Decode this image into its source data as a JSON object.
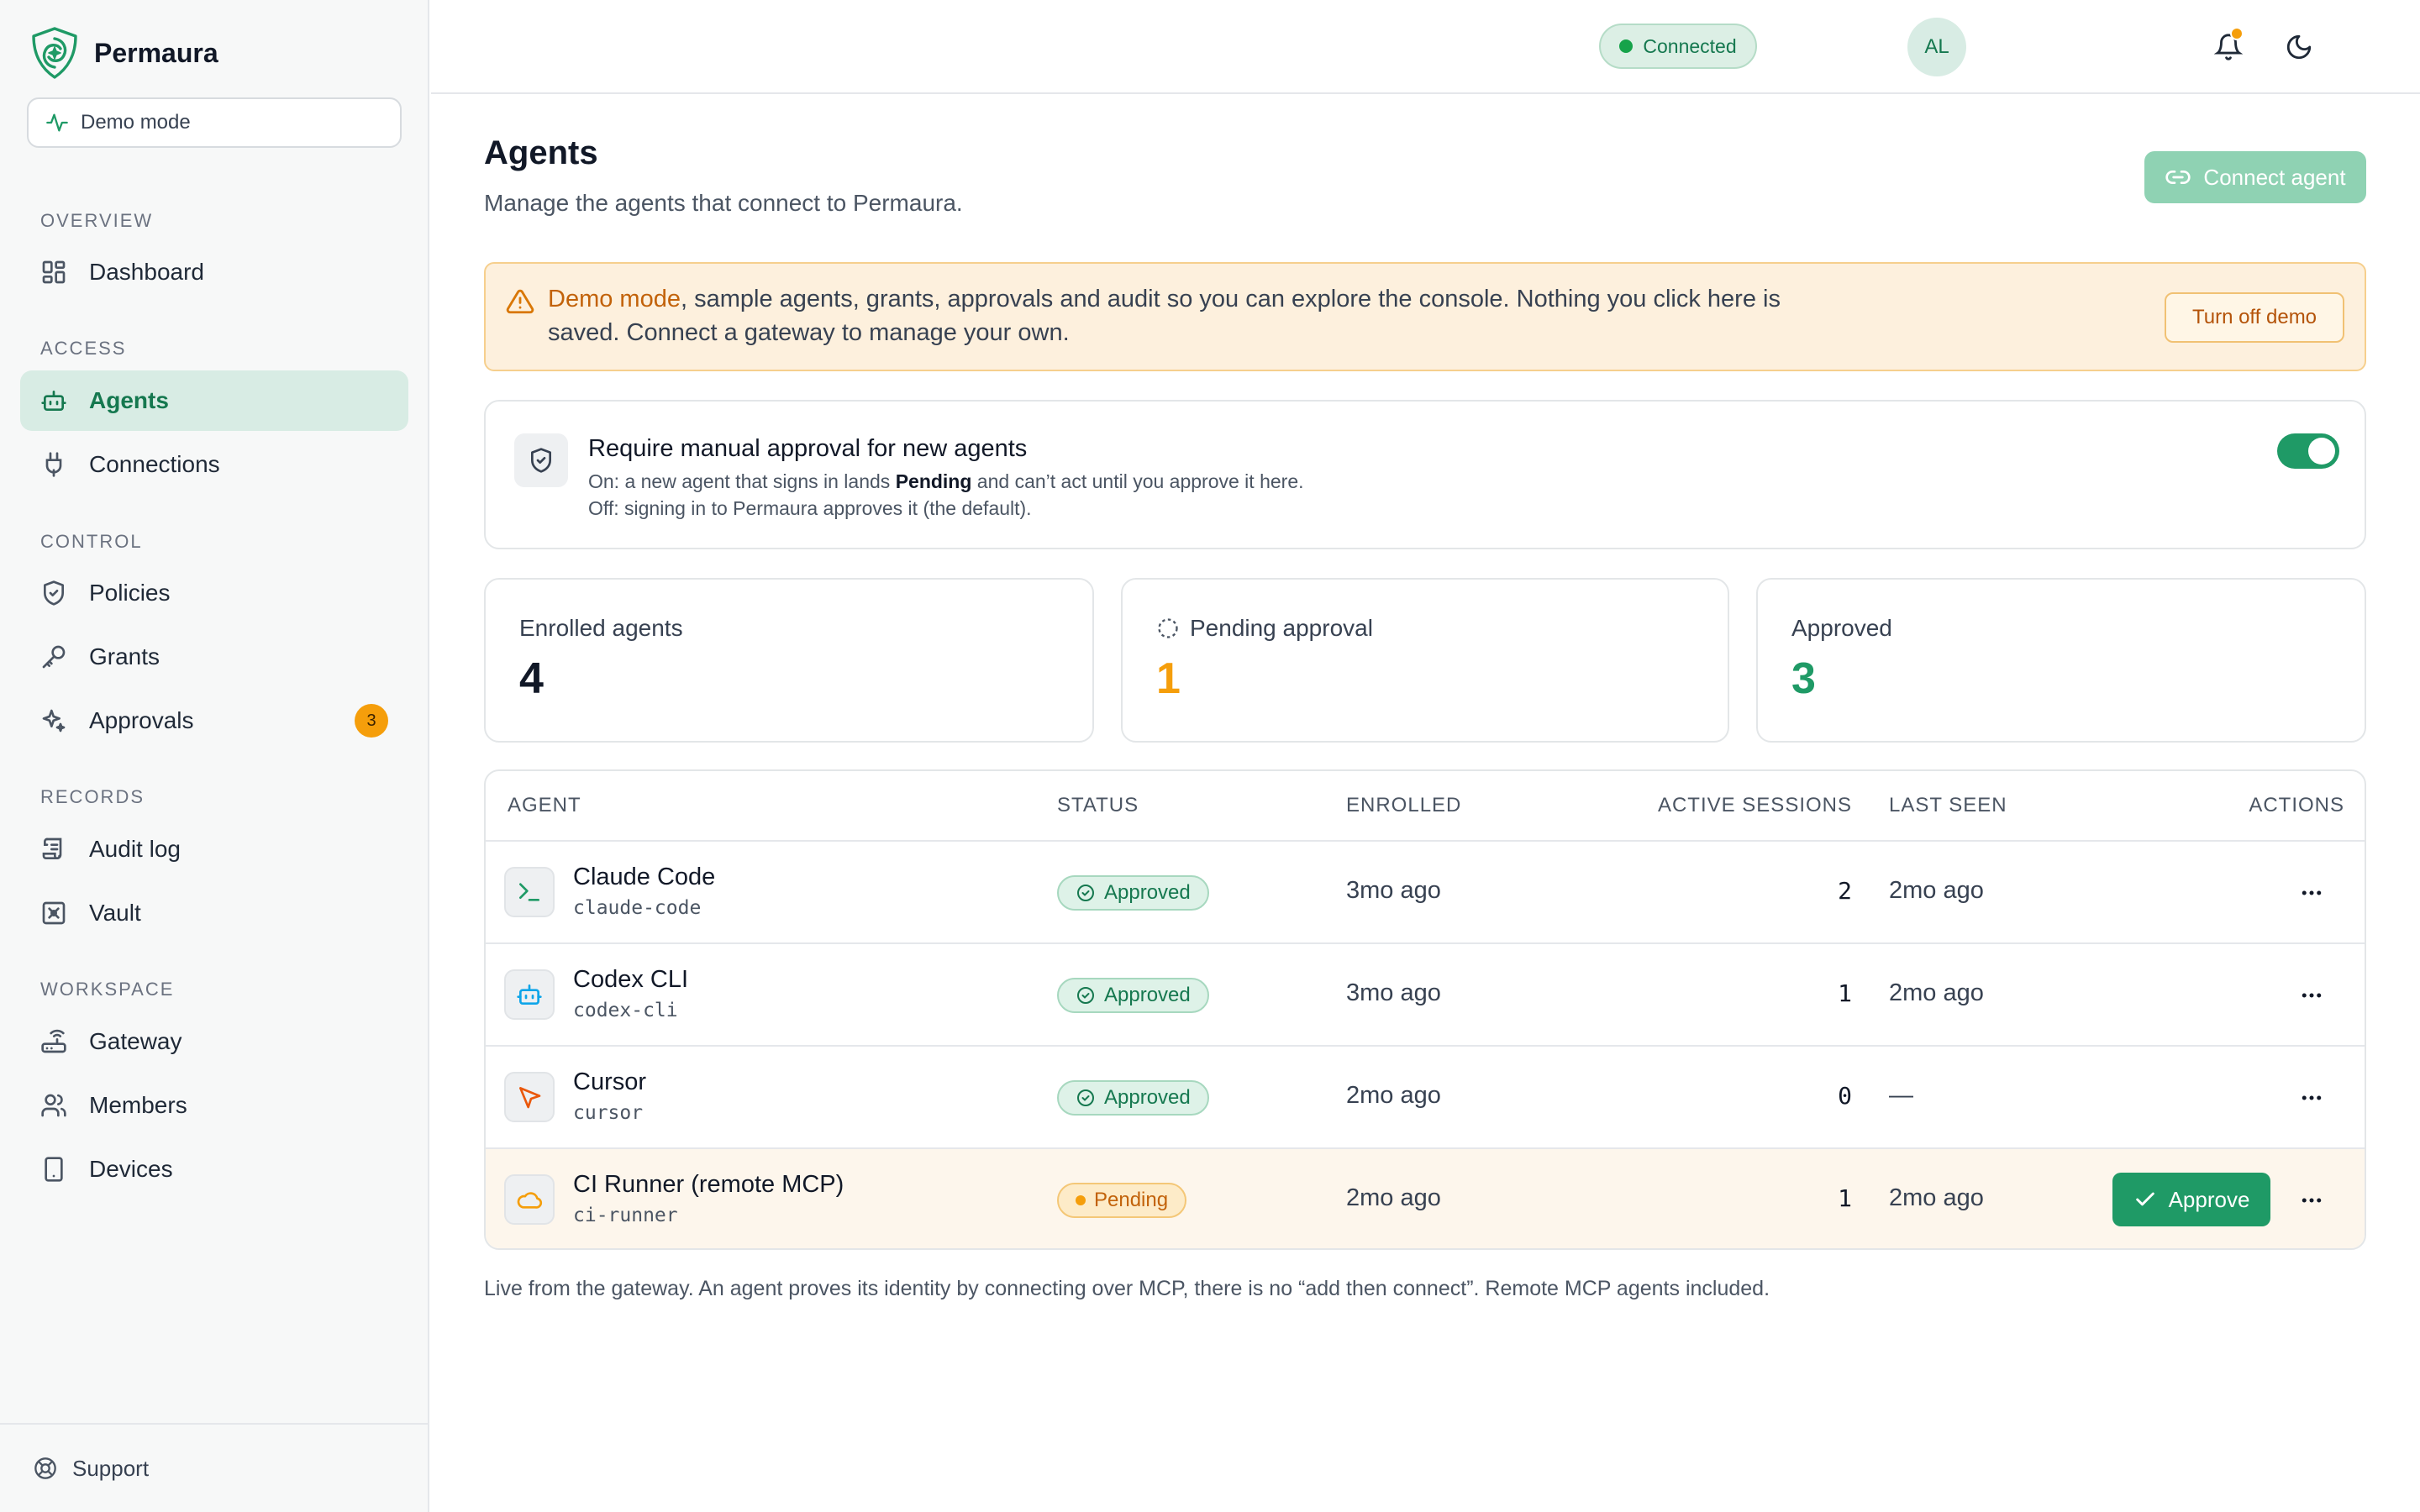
{
  "brand": {
    "name": "Permaura"
  },
  "demo_pill": {
    "label": "Demo mode"
  },
  "sidebar": {
    "sections": {
      "overview": "Overview",
      "access": "Access",
      "control": "Control",
      "records": "Records",
      "workspace": "Workspace"
    },
    "items": {
      "dashboard": "Dashboard",
      "agents": "Agents",
      "connections": "Connections",
      "policies": "Policies",
      "grants": "Grants",
      "approvals": "Approvals",
      "audit_log": "Audit log",
      "vault": "Vault",
      "gateway": "Gateway",
      "members": "Members",
      "devices": "Devices"
    },
    "approvals_badge": "3",
    "support": "Support"
  },
  "topbar": {
    "status": "Connected",
    "avatar_initials": "AL"
  },
  "page": {
    "title": "Agents",
    "subtitle": "Manage the agents that connect to Permaura.",
    "connect_button": "Connect agent"
  },
  "banner": {
    "highlight": "Demo mode",
    "text": ", sample agents, grants, approvals and audit so you can explore the console. Nothing you click here is saved. Connect a gateway to manage your own.",
    "button": "Turn off demo"
  },
  "approval_setting": {
    "title": "Require manual approval for new agents",
    "on_prefix": "On: a new agent that signs in lands ",
    "on_bold": "Pending",
    "on_suffix": " and can’t act until you approve it here.",
    "off_line": "Off: signing in to Permaura approves it (the default).",
    "enabled": true
  },
  "stats": {
    "enrolled": {
      "label": "Enrolled agents",
      "value": "4"
    },
    "pending": {
      "label": "Pending approval",
      "value": "1"
    },
    "approved": {
      "label": "Approved",
      "value": "3"
    }
  },
  "colors": {
    "accent": "#1f9a66",
    "pending": "#f59e0b",
    "text": "#111827"
  },
  "table": {
    "headers": {
      "agent": "AGENT",
      "status": "STATUS",
      "enrolled": "ENROLLED",
      "sessions": "ACTIVE SESSIONS",
      "last_seen": "LAST SEEN",
      "actions": "ACTIONS"
    },
    "rows": [
      {
        "name": "Claude Code",
        "slug": "claude-code",
        "icon": "terminal-icon",
        "status": "Approved",
        "enrolled": "3mo ago",
        "sessions": "2",
        "last_seen": "2mo ago"
      },
      {
        "name": "Codex CLI",
        "slug": "codex-cli",
        "icon": "robot-icon",
        "status": "Approved",
        "enrolled": "3mo ago",
        "sessions": "1",
        "last_seen": "2mo ago"
      },
      {
        "name": "Cursor",
        "slug": "cursor",
        "icon": "cursor-icon",
        "status": "Approved",
        "enrolled": "2mo ago",
        "sessions": "0",
        "last_seen": "—"
      },
      {
        "name": "CI Runner (remote MCP)",
        "slug": "ci-runner",
        "icon": "cloud-icon",
        "status": "Pending",
        "enrolled": "2mo ago",
        "sessions": "1",
        "last_seen": "2mo ago",
        "action": "Approve"
      }
    ]
  },
  "footnote": "Live from the gateway. An agent proves its identity by connecting over MCP, there is no “add then connect”. Remote MCP agents included."
}
